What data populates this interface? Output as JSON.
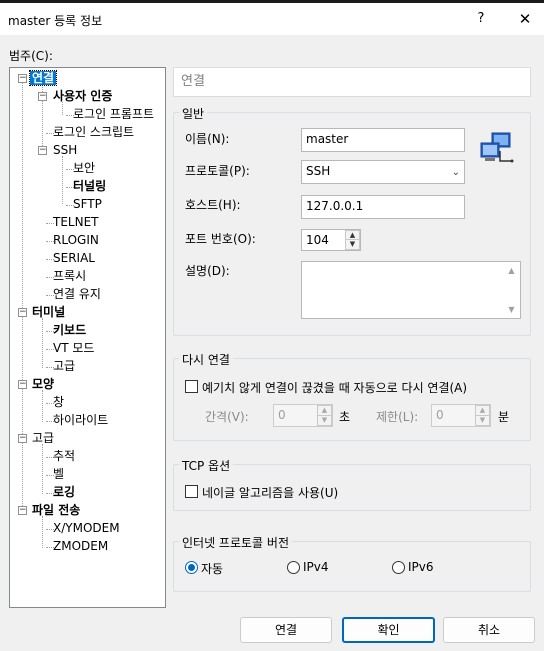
{
  "window": {
    "title": "master 등록 정보",
    "help_glyph": "?",
    "close_glyph": "✕"
  },
  "category_label": "범주(C):",
  "tree": [
    {
      "label": "연결",
      "bold": true,
      "selected": true
    },
    {
      "label": "사용자 인증",
      "bold": true
    },
    {
      "label": "로그인 프롬프트",
      "bold": false
    },
    {
      "label": "로그인 스크립트",
      "bold": false
    },
    {
      "label": "SSH",
      "bold": false
    },
    {
      "label": "보안",
      "bold": false
    },
    {
      "label": "터널링",
      "bold": true
    },
    {
      "label": "SFTP",
      "bold": false
    },
    {
      "label": "TELNET",
      "bold": false
    },
    {
      "label": "RLOGIN",
      "bold": false
    },
    {
      "label": "SERIAL",
      "bold": false
    },
    {
      "label": "프록시",
      "bold": false
    },
    {
      "label": "연결 유지",
      "bold": false
    },
    {
      "label": "터미널",
      "bold": true
    },
    {
      "label": "키보드",
      "bold": true
    },
    {
      "label": "VT 모드",
      "bold": false
    },
    {
      "label": "고급",
      "bold": false
    },
    {
      "label": "모양",
      "bold": true
    },
    {
      "label": "창",
      "bold": false
    },
    {
      "label": "하이라이트",
      "bold": false
    },
    {
      "label": "고급",
      "bold": false
    },
    {
      "label": "추적",
      "bold": false
    },
    {
      "label": "벨",
      "bold": false
    },
    {
      "label": "로깅",
      "bold": true
    },
    {
      "label": "파일 전송",
      "bold": true
    },
    {
      "label": "X/YMODEM",
      "bold": false
    },
    {
      "label": "ZMODEM",
      "bold": false
    }
  ],
  "panel": {
    "header": "연결",
    "general": {
      "title": "일반",
      "name_label": "이름(N):",
      "name_value": "master",
      "protocol_label": "프로토콜(P):",
      "protocol_value": "SSH",
      "host_label": "호스트(H):",
      "host_value": "127.0.0.1",
      "port_label": "포트 번호(O):",
      "port_value": "104",
      "desc_label": "설명(D):",
      "desc_value": ""
    },
    "reconnect": {
      "title": "다시 연결",
      "checkbox_label": "예기치 않게 연결이 끊겼을 때 자동으로 다시 연결(A)",
      "checked": false,
      "interval_label": "간격(V):",
      "interval_value": "0",
      "interval_unit": "초",
      "limit_label": "제한(L):",
      "limit_value": "0",
      "limit_unit": "분"
    },
    "tcp": {
      "title": "TCP 옵션",
      "checkbox_label": "네이글 알고리즘을 사용(U)",
      "checked": false
    },
    "ipver": {
      "title": "인터넷 프로토콜 버전",
      "options": [
        "자동",
        "IPv4",
        "IPv6"
      ],
      "selected": "자동"
    }
  },
  "buttons": {
    "connect": "연결",
    "ok": "확인",
    "cancel": "취소"
  },
  "icons": {
    "network_icon": "network-computers-icon"
  }
}
